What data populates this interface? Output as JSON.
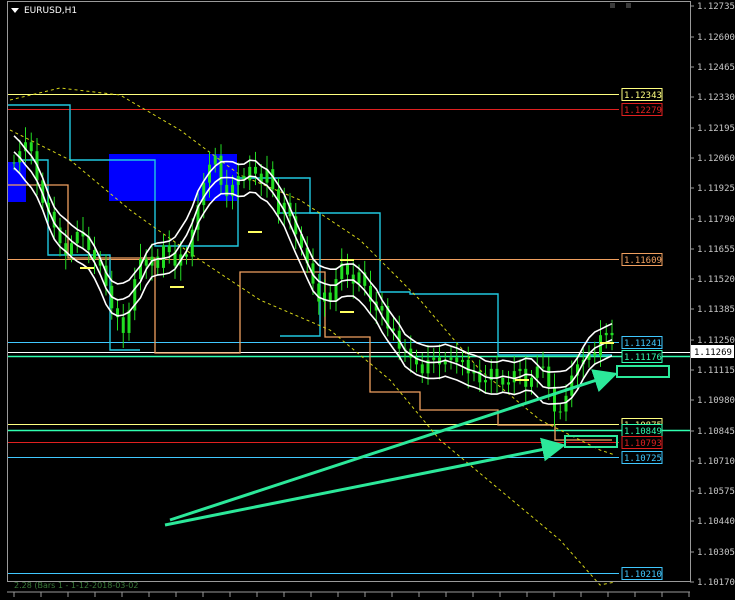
{
  "header": {
    "symbol_label": "EURUSD,H1"
  },
  "footer": {
    "watermark": "2.28 (Bars 1 - 1-12-2018-03-02"
  },
  "colors": {
    "background": "#000000",
    "frame": "#9a9a9a",
    "candles": "#22dd22",
    "envelope": "#ffffff",
    "dashed_band": "#d4d418",
    "step_cyan": "#20c8e0",
    "step_orange": "#f0a060",
    "arrows": "#2ce89a",
    "zone_blue": "#0000ff",
    "level_yellow": "#ffff80",
    "level_red": "#e02020",
    "level_orange": "#f0a060",
    "level_cyan": "#40c8ff",
    "level_white": "#e0e0e0",
    "level_green": "#30ffb0"
  },
  "chart_data": {
    "type": "candlestick",
    "title": "EURUSD,H1",
    "ylim": [
      1.1017,
      1.12755
    ],
    "yticks": [
      "1.12735",
      "1.12600",
      "1.12465",
      "1.12330",
      "1.12195",
      "1.12060",
      "1.11925",
      "1.11790",
      "1.11655",
      "1.11520",
      "1.11385",
      "1.11250",
      "1.11115",
      "1.10980",
      "1.10845",
      "1.10710",
      "1.10575",
      "1.10440",
      "1.10305",
      "1.10170"
    ],
    "current_price": "1.11269",
    "price_levels": [
      {
        "label": "1.12343",
        "value": 1.12343,
        "color": "#ffff80",
        "kind": "line"
      },
      {
        "label": "1.12279",
        "value": 1.12279,
        "color": "#e02020",
        "kind": "line"
      },
      {
        "label": "1.11609",
        "value": 1.11609,
        "color": "#f0a060",
        "kind": "line"
      },
      {
        "label": "1.11241",
        "value": 1.11241,
        "color": "#40c8ff",
        "kind": "line"
      },
      {
        "label": "1.11176",
        "value": 1.11176,
        "color": "#30ffb0",
        "kind": "line"
      },
      {
        "label": "1.10875",
        "value": 1.10875,
        "color": "#ffff80",
        "kind": "line"
      },
      {
        "label": "1.10849",
        "value": 1.10849,
        "color": "#30ffb0",
        "kind": "line"
      },
      {
        "label": "1.10793",
        "value": 1.10793,
        "color": "#e02020",
        "kind": "line"
      },
      {
        "label": "1.10725",
        "value": 1.10725,
        "color": "#40c8ff",
        "kind": "line"
      },
      {
        "label": "1.10210",
        "value": 1.1021,
        "color": "#40c8ff",
        "kind": "line"
      }
    ],
    "series": [
      {
        "name": "close",
        "values": [
          1.1204,
          1.1209,
          1.1213,
          1.1209,
          1.1196,
          1.1186,
          1.1182,
          1.1175,
          1.1168,
          1.1163,
          1.1168,
          1.1173,
          1.1171,
          1.1165,
          1.1161,
          1.1158,
          1.1149,
          1.1139,
          1.1135,
          1.1128,
          1.1138,
          1.1152,
          1.1161,
          1.1158,
          1.1162,
          1.1157,
          1.1167,
          1.1164,
          1.1158,
          1.1163,
          1.1162,
          1.1174,
          1.1185,
          1.1195,
          1.1203,
          1.1207,
          1.1194,
          1.1189,
          1.1194,
          1.1198,
          1.1196,
          1.1202,
          1.1199,
          1.1195,
          1.1201,
          1.1192,
          1.1181,
          1.1186,
          1.118,
          1.1172,
          1.1166,
          1.1159,
          1.115,
          1.1142,
          1.1146,
          1.1142,
          1.1152,
          1.1159,
          1.1154,
          1.115,
          1.1155,
          1.1149,
          1.1142,
          1.1138,
          1.114,
          1.113,
          1.1129,
          1.1121,
          1.1121,
          1.1117,
          1.1114,
          1.111,
          1.1116,
          1.1117,
          1.1114,
          1.1116,
          1.1117,
          1.1115,
          1.1116,
          1.111,
          1.1111,
          1.1106,
          1.1107,
          1.1112,
          1.1108,
          1.1105,
          1.1106,
          1.1111,
          1.1112,
          1.1104,
          1.1108,
          1.1113,
          1.1113,
          1.1104,
          1.1093,
          1.1093,
          1.11,
          1.1109,
          1.1114,
          1.1116,
          1.1119,
          1.1118,
          1.1127,
          1.1128,
          1.1127
        ]
      }
    ]
  }
}
